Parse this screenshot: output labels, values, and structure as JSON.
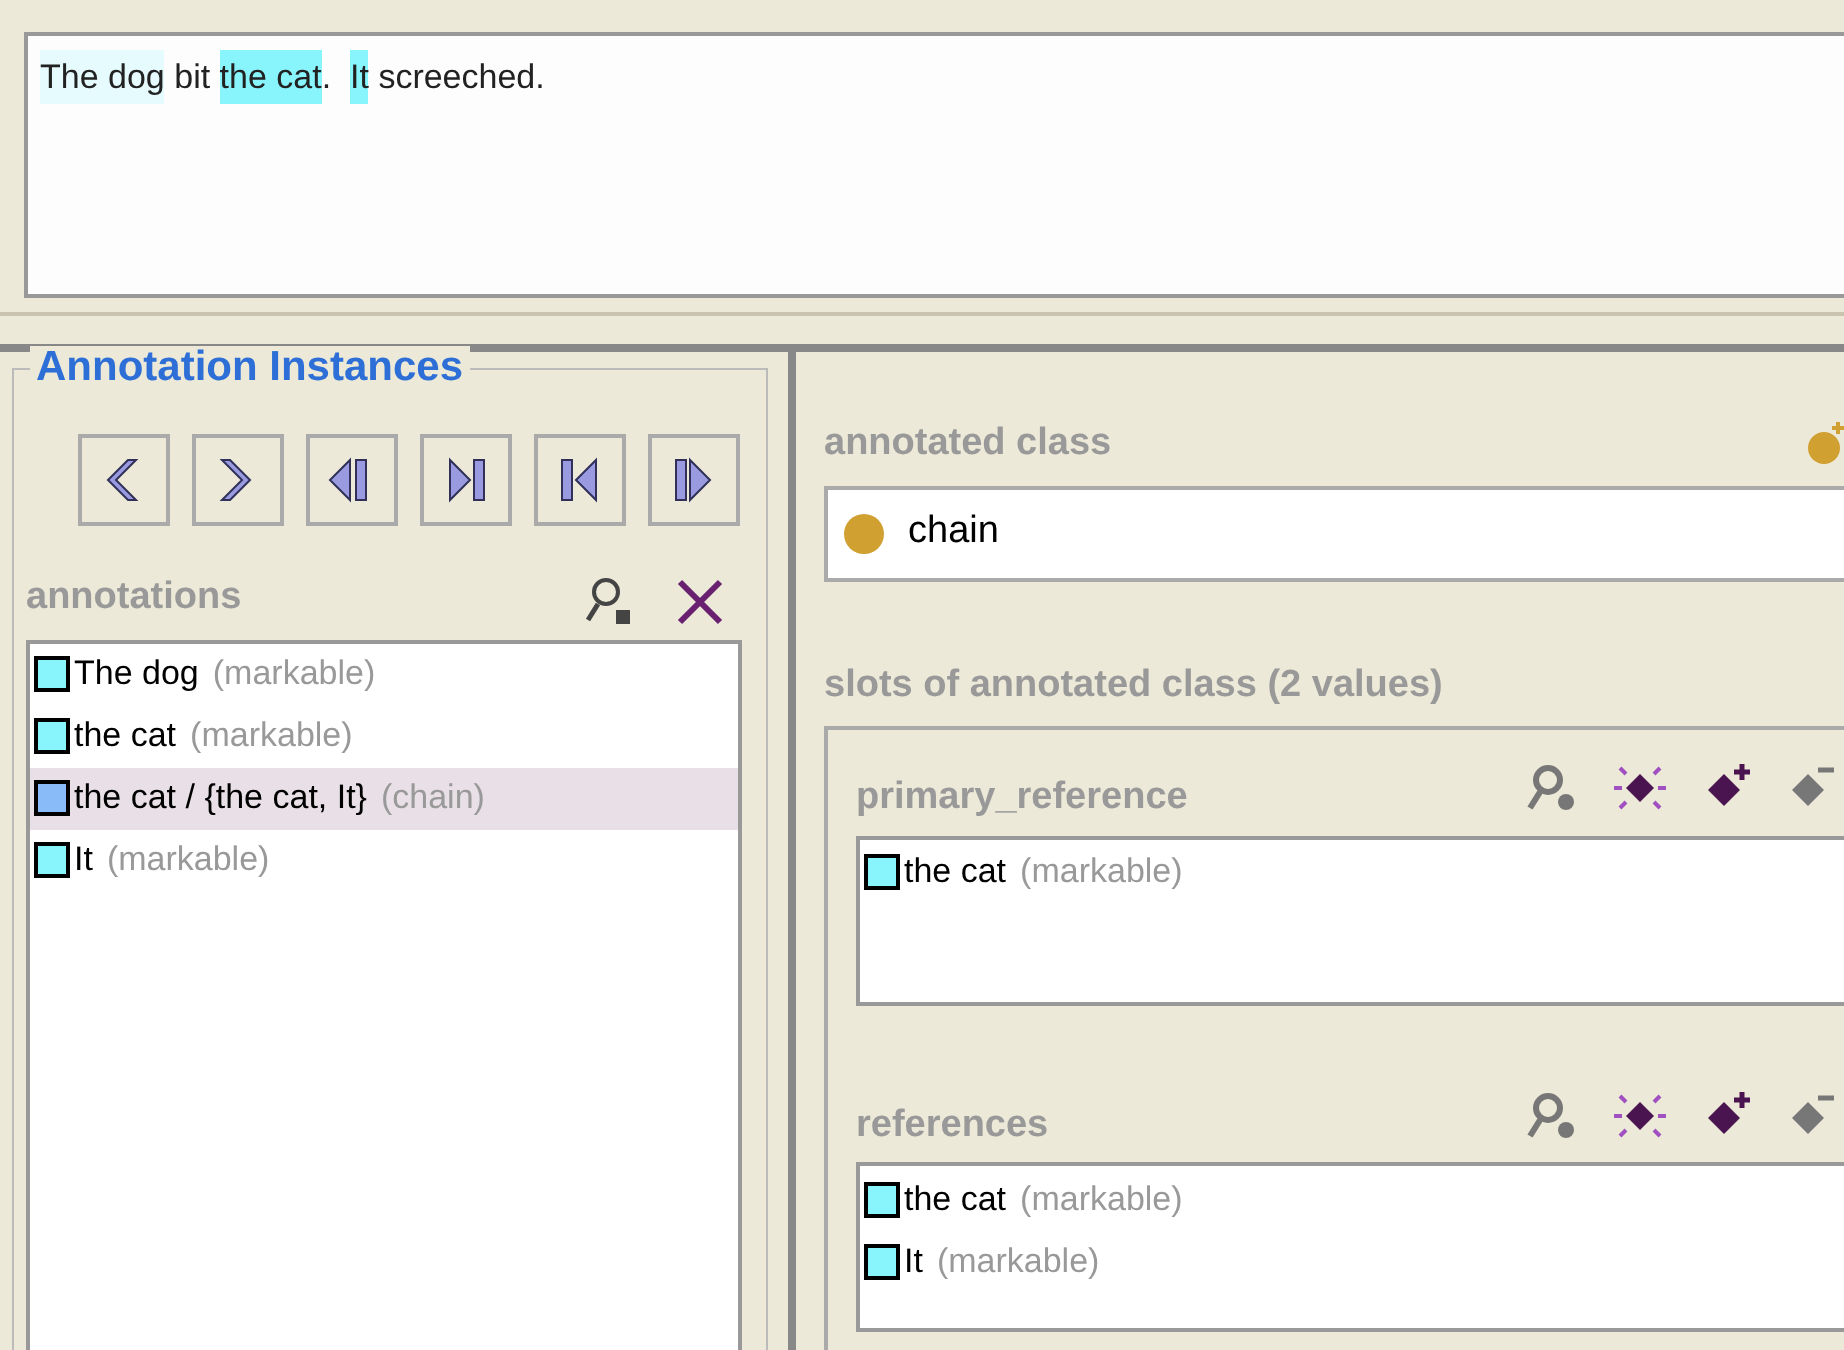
{
  "document": {
    "segments": [
      {
        "text": "The dog",
        "color": "#e6fbfd"
      },
      {
        "text": " bit "
      },
      {
        "text": "the cat",
        "color": "#88f4fc"
      },
      {
        "text": ".  "
      },
      {
        "text": "It",
        "color": "#88f4fc"
      },
      {
        "text": " screeched."
      }
    ]
  },
  "instances": {
    "title": "Annotation Instances",
    "nav_buttons": [
      {
        "kind": "previous"
      },
      {
        "kind": "next"
      },
      {
        "kind": "previous-span"
      },
      {
        "kind": "next-span"
      },
      {
        "kind": "first"
      },
      {
        "kind": "last"
      }
    ],
    "list_label": "annotations",
    "annotations": [
      {
        "label": "The dog",
        "type": "(markable)",
        "color": "#88f4fc",
        "selected": false
      },
      {
        "label": "the cat",
        "type": "(markable)",
        "color": "#88f4fc",
        "selected": false
      },
      {
        "label": "the cat / {the cat, It}",
        "type": "(chain)",
        "color": "#88bbf8",
        "selected": true
      },
      {
        "label": "It",
        "type": "(markable)",
        "color": "#88f4fc",
        "selected": false
      }
    ]
  },
  "details": {
    "class_label": "annotated class",
    "class_value": "chain",
    "slots_label": "slots of annotated class (2 values)",
    "slots": [
      {
        "name": "primary_reference",
        "values": [
          {
            "label": "the cat",
            "type": "(markable)",
            "color": "#88f4fc"
          }
        ]
      },
      {
        "name": "references",
        "values": [
          {
            "label": "the cat",
            "type": "(markable)",
            "color": "#88f4fc"
          },
          {
            "label": "It",
            "type": "(markable)",
            "color": "#88f4fc"
          }
        ]
      }
    ]
  }
}
